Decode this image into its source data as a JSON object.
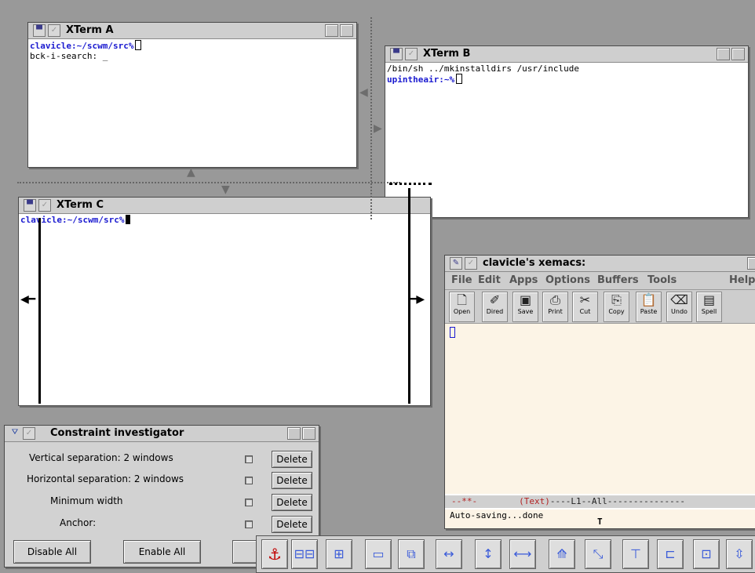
{
  "colors": {
    "desktop": "#999999",
    "prompt": "#1a1ad0",
    "emacs_buffer": "#fcf4e6",
    "mode_text": "#b22222"
  },
  "xterm_a": {
    "title": "XTerm A",
    "prompt": "clavicle:~/scwm/src%",
    "line2": "bck-i-search: _"
  },
  "xterm_b": {
    "title": "XTerm B",
    "line1": "/bin/sh ../mkinstalldirs /usr/include",
    "prompt": "upintheair:~%"
  },
  "xterm_c": {
    "title": "XTerm C",
    "prompt": "clavicle:~/scwm/src%"
  },
  "xemacs": {
    "title": "clavicle's xemacs:",
    "menu": [
      "File",
      "Edit",
      "Apps",
      "Options",
      "Buffers",
      "Tools",
      "Help"
    ],
    "toolbar": [
      {
        "label": "Open",
        "icon": "open-file-icon"
      },
      {
        "label": "Dired",
        "icon": "dired-icon"
      },
      {
        "label": "Save",
        "icon": "save-icon"
      },
      {
        "label": "Print",
        "icon": "print-icon"
      },
      {
        "label": "Cut",
        "icon": "scissors-icon"
      },
      {
        "label": "Copy",
        "icon": "copy-icon"
      },
      {
        "label": "Paste",
        "icon": "paste-icon"
      },
      {
        "label": "Undo",
        "icon": "undo-icon"
      },
      {
        "label": "Spell",
        "icon": "spell-icon"
      }
    ],
    "modeline_prefix": "--**-",
    "modeline_mode": "(Text)",
    "modeline_rest": "----L1--All---------------",
    "minibuffer": "Auto-saving...done"
  },
  "constraint_investigator": {
    "title": "Constraint investigator",
    "rows": [
      {
        "label": "Vertical separation: 2 windows",
        "button": "Delete"
      },
      {
        "label": "Horizontal separation: 2 windows",
        "button": "Delete"
      },
      {
        "label": "Minimum width",
        "button": "Delete"
      },
      {
        "label": "Anchor:",
        "button": "Delete"
      }
    ],
    "disable_all": "Disable All",
    "enable_all": "Enable All"
  },
  "palette": {
    "tools": [
      "anchor-icon",
      "horizontal-align-icon",
      "vertical-align-icon",
      "right-align-icon",
      "overlap-icon",
      "horizontal-separation-icon",
      "vertical-separation-icon",
      "min-width-icon",
      "min-height-icon",
      "diagonal-link-icon",
      "top-edge-icon",
      "center-align-icon",
      "strict-relative-size-icon",
      "relative-height-icon"
    ]
  }
}
